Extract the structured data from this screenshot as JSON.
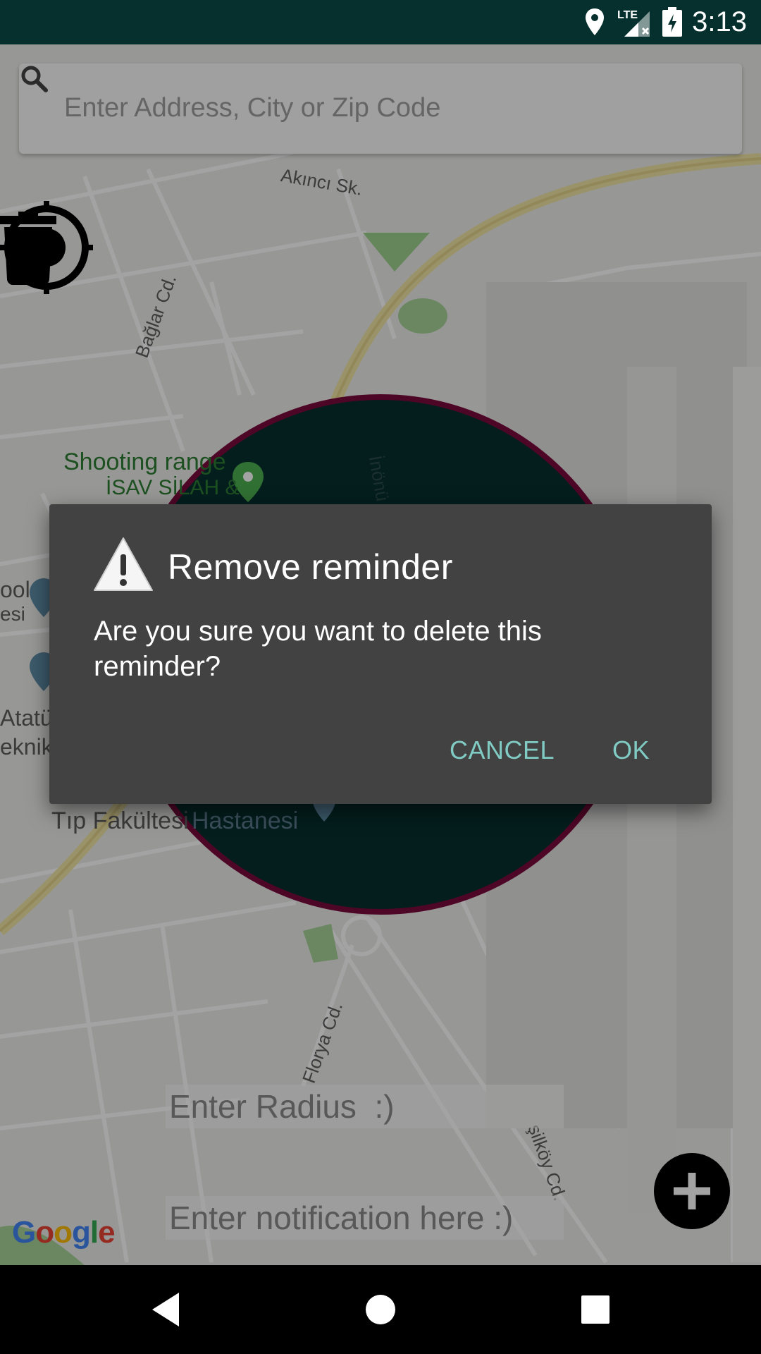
{
  "status_bar": {
    "time": "3:13",
    "network": "LTE",
    "icons": [
      "location-icon",
      "signal-icon",
      "battery-charging-icon"
    ]
  },
  "search": {
    "placeholder": "Enter Address, City or Zip Code"
  },
  "map": {
    "labels": {
      "akinci": "Akıncı Sk.",
      "baglar": "Bağlar Cd.",
      "shooting_range": "Shooting range",
      "isav": "İSAV SİLAH &",
      "inonu": "İnönü",
      "ool": "ool",
      "esi": "esi",
      "ataturk": "Atatür",
      "teknik": "eknik",
      "tip": "Tıp Fakültesi",
      "hastanesi": "Hastanesi",
      "florya": "Florya Cd.",
      "yesilkoy": "şilköy Cd."
    },
    "geofence_fill": "#05302e",
    "geofence_stroke": "#7b0a3c",
    "logo_text": "Google"
  },
  "inputs": {
    "radius_placeholder": "Enter Radius  :)",
    "notification_placeholder": "Enter notification here :)"
  },
  "dialog": {
    "title": "Remove reminder",
    "message": "Are you sure you want to delete this reminder?",
    "cancel_label": "CANCEL",
    "ok_label": "OK",
    "accent_color": "#80cbc4"
  },
  "nav_bar": {
    "icons": [
      "back-icon",
      "home-icon",
      "recents-icon"
    ]
  }
}
